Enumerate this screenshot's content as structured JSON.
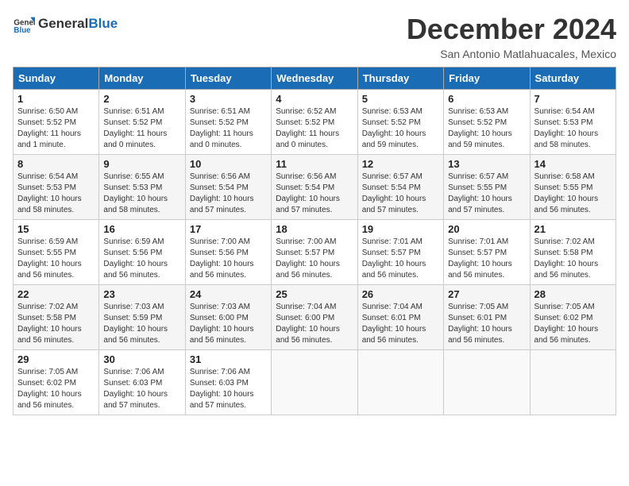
{
  "logo": {
    "general": "General",
    "blue": "Blue"
  },
  "header": {
    "month": "December 2024",
    "location": "San Antonio Matlahuacales, Mexico"
  },
  "weekdays": [
    "Sunday",
    "Monday",
    "Tuesday",
    "Wednesday",
    "Thursday",
    "Friday",
    "Saturday"
  ],
  "weeks": [
    [
      {
        "day": "1",
        "sunrise": "6:50 AM",
        "sunset": "5:52 PM",
        "daylight": "11 hours and 1 minute."
      },
      {
        "day": "2",
        "sunrise": "6:51 AM",
        "sunset": "5:52 PM",
        "daylight": "11 hours and 0 minutes."
      },
      {
        "day": "3",
        "sunrise": "6:51 AM",
        "sunset": "5:52 PM",
        "daylight": "11 hours and 0 minutes."
      },
      {
        "day": "4",
        "sunrise": "6:52 AM",
        "sunset": "5:52 PM",
        "daylight": "11 hours and 0 minutes."
      },
      {
        "day": "5",
        "sunrise": "6:53 AM",
        "sunset": "5:52 PM",
        "daylight": "10 hours and 59 minutes."
      },
      {
        "day": "6",
        "sunrise": "6:53 AM",
        "sunset": "5:52 PM",
        "daylight": "10 hours and 59 minutes."
      },
      {
        "day": "7",
        "sunrise": "6:54 AM",
        "sunset": "5:53 PM",
        "daylight": "10 hours and 58 minutes."
      }
    ],
    [
      {
        "day": "8",
        "sunrise": "6:54 AM",
        "sunset": "5:53 PM",
        "daylight": "10 hours and 58 minutes."
      },
      {
        "day": "9",
        "sunrise": "6:55 AM",
        "sunset": "5:53 PM",
        "daylight": "10 hours and 58 minutes."
      },
      {
        "day": "10",
        "sunrise": "6:56 AM",
        "sunset": "5:54 PM",
        "daylight": "10 hours and 57 minutes."
      },
      {
        "day": "11",
        "sunrise": "6:56 AM",
        "sunset": "5:54 PM",
        "daylight": "10 hours and 57 minutes."
      },
      {
        "day": "12",
        "sunrise": "6:57 AM",
        "sunset": "5:54 PM",
        "daylight": "10 hours and 57 minutes."
      },
      {
        "day": "13",
        "sunrise": "6:57 AM",
        "sunset": "5:55 PM",
        "daylight": "10 hours and 57 minutes."
      },
      {
        "day": "14",
        "sunrise": "6:58 AM",
        "sunset": "5:55 PM",
        "daylight": "10 hours and 56 minutes."
      }
    ],
    [
      {
        "day": "15",
        "sunrise": "6:59 AM",
        "sunset": "5:55 PM",
        "daylight": "10 hours and 56 minutes."
      },
      {
        "day": "16",
        "sunrise": "6:59 AM",
        "sunset": "5:56 PM",
        "daylight": "10 hours and 56 minutes."
      },
      {
        "day": "17",
        "sunrise": "7:00 AM",
        "sunset": "5:56 PM",
        "daylight": "10 hours and 56 minutes."
      },
      {
        "day": "18",
        "sunrise": "7:00 AM",
        "sunset": "5:57 PM",
        "daylight": "10 hours and 56 minutes."
      },
      {
        "day": "19",
        "sunrise": "7:01 AM",
        "sunset": "5:57 PM",
        "daylight": "10 hours and 56 minutes."
      },
      {
        "day": "20",
        "sunrise": "7:01 AM",
        "sunset": "5:57 PM",
        "daylight": "10 hours and 56 minutes."
      },
      {
        "day": "21",
        "sunrise": "7:02 AM",
        "sunset": "5:58 PM",
        "daylight": "10 hours and 56 minutes."
      }
    ],
    [
      {
        "day": "22",
        "sunrise": "7:02 AM",
        "sunset": "5:58 PM",
        "daylight": "10 hours and 56 minutes."
      },
      {
        "day": "23",
        "sunrise": "7:03 AM",
        "sunset": "5:59 PM",
        "daylight": "10 hours and 56 minutes."
      },
      {
        "day": "24",
        "sunrise": "7:03 AM",
        "sunset": "6:00 PM",
        "daylight": "10 hours and 56 minutes."
      },
      {
        "day": "25",
        "sunrise": "7:04 AM",
        "sunset": "6:00 PM",
        "daylight": "10 hours and 56 minutes."
      },
      {
        "day": "26",
        "sunrise": "7:04 AM",
        "sunset": "6:01 PM",
        "daylight": "10 hours and 56 minutes."
      },
      {
        "day": "27",
        "sunrise": "7:05 AM",
        "sunset": "6:01 PM",
        "daylight": "10 hours and 56 minutes."
      },
      {
        "day": "28",
        "sunrise": "7:05 AM",
        "sunset": "6:02 PM",
        "daylight": "10 hours and 56 minutes."
      }
    ],
    [
      {
        "day": "29",
        "sunrise": "7:05 AM",
        "sunset": "6:02 PM",
        "daylight": "10 hours and 56 minutes."
      },
      {
        "day": "30",
        "sunrise": "7:06 AM",
        "sunset": "6:03 PM",
        "daylight": "10 hours and 57 minutes."
      },
      {
        "day": "31",
        "sunrise": "7:06 AM",
        "sunset": "6:03 PM",
        "daylight": "10 hours and 57 minutes."
      },
      null,
      null,
      null,
      null
    ]
  ]
}
